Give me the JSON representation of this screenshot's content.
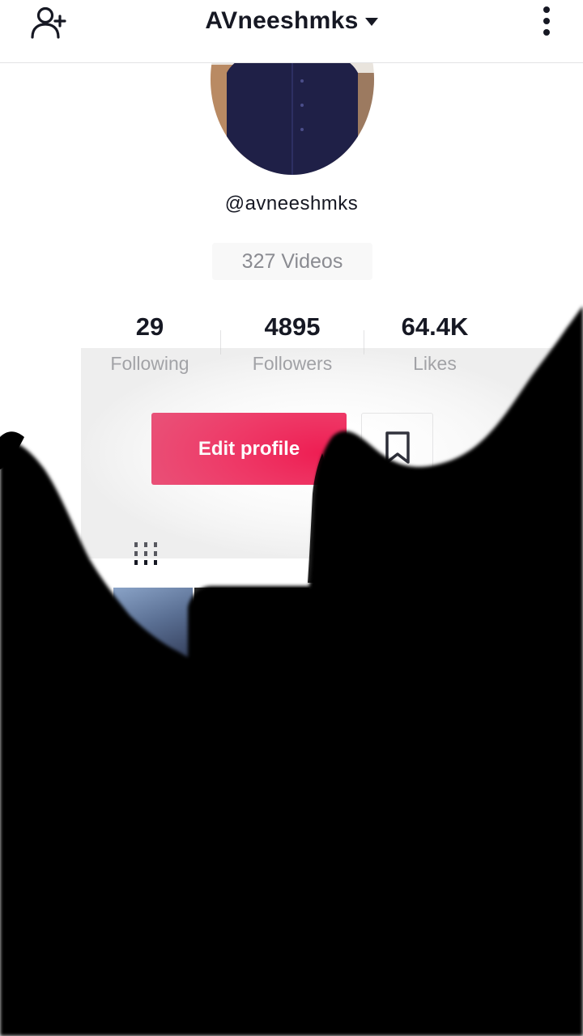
{
  "header": {
    "title": "AVneeshmks",
    "add_user_icon": "add-user-icon",
    "dropdown_icon": "caret-down-icon",
    "more_icon": "more-vertical-icon"
  },
  "profile": {
    "handle": "@avneeshmks",
    "videos_label": "327 Videos"
  },
  "stats": [
    {
      "value": "29",
      "label": "Following"
    },
    {
      "value": "4895",
      "label": "Followers"
    },
    {
      "value": "64.4K",
      "label": "Likes"
    }
  ],
  "actions": {
    "edit_profile": "Edit profile",
    "bookmark_icon": "bookmark-icon"
  },
  "tabs": {
    "videos_grid_icon": "grid-icon"
  },
  "colors": {
    "accent": "#ee1d52",
    "text": "#161823",
    "muted": "#8a8b91"
  }
}
